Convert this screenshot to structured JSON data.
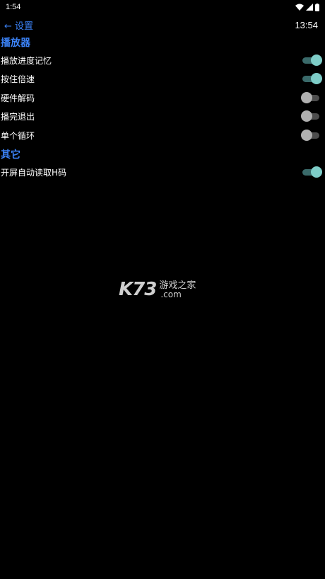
{
  "status_bar": {
    "time": "1:54",
    "icons": [
      "wifi-icon",
      "signal-icon",
      "battery-icon"
    ]
  },
  "header": {
    "back_label": "← 设置",
    "clock": "13:54"
  },
  "sections": [
    {
      "title": "播放器",
      "items": [
        {
          "label": "播放进度记忆",
          "on": true
        },
        {
          "label": "按住倍速",
          "on": true
        },
        {
          "label": "硬件解码",
          "on": false
        },
        {
          "label": "播完退出",
          "on": false
        },
        {
          "label": "单个循环",
          "on": false
        }
      ]
    },
    {
      "title": "其它",
      "items": [
        {
          "label": "开屏自动读取H码",
          "on": true
        }
      ]
    }
  ],
  "watermark": {
    "logo": "K73",
    "cn": "游戏之家",
    "com": ".com"
  },
  "colors": {
    "accent": "#3b82f6",
    "toggle_on": "#7ecdc8",
    "toggle_off": "#b0b0b0",
    "background": "#000000"
  }
}
